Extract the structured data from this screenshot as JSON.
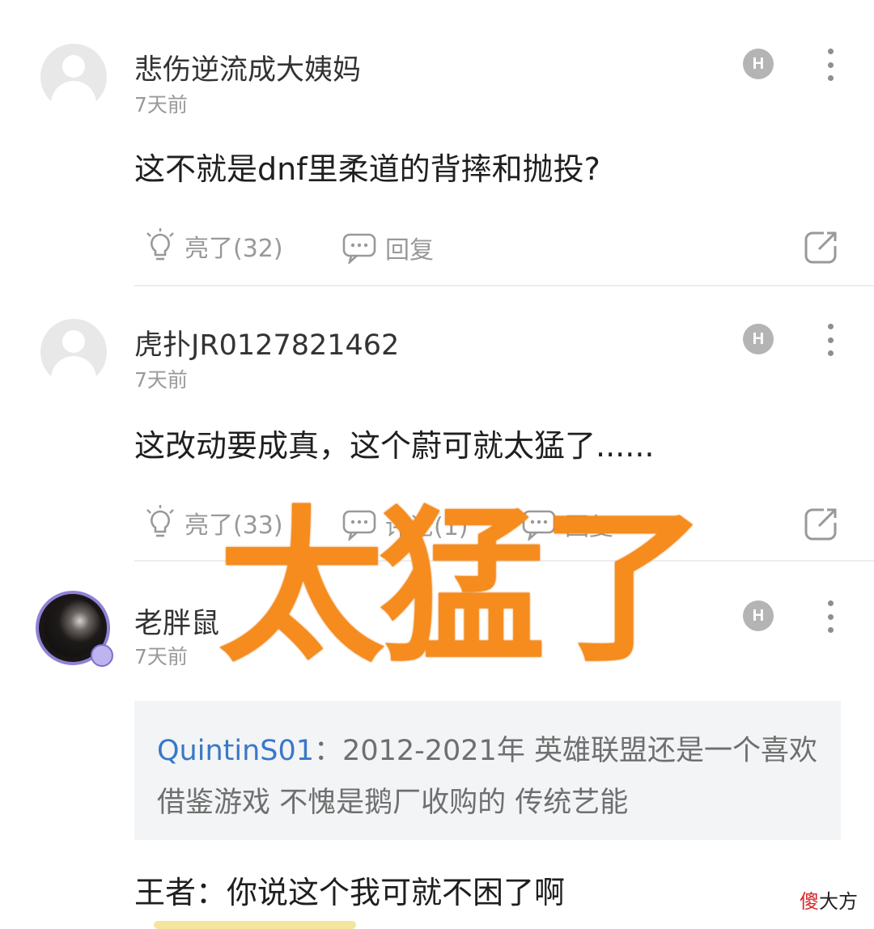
{
  "comments": [
    {
      "username": "悲伤逆流成大姨妈",
      "time": "7天前",
      "text": "这不就是dnf里柔道的背摔和抛投?",
      "like_label": "亮了(32)",
      "reply_label": "回复"
    },
    {
      "username": "虎扑JR0127821462",
      "time": "7天前",
      "text": "这改动要成真，这个蔚可就太猛了......",
      "like_label": "亮了(33)",
      "reply_count_label": "评论(1)",
      "reply_label": "回复"
    },
    {
      "username": "老胖鼠",
      "time": "7天前",
      "quote": {
        "user": "QuintinS01",
        "separator": "：",
        "text": "2012-2021年 英雄联盟还是一个喜欢借鉴游戏 不愧是鹅厂收购的 传统艺能"
      },
      "text": "王者：你说这个我可就不困了啊"
    }
  ],
  "h_badge_label": "H",
  "overlay_text": "太猛了",
  "watermark": {
    "first": "傻",
    "rest": "大方"
  },
  "colors": {
    "accent_orange": "#f58c1d",
    "link_blue": "#3a77c8",
    "watermark_red": "#d8262b"
  },
  "icons": [
    "avatar-placeholder-icon",
    "lightbulb-icon",
    "comment-icon",
    "share-icon",
    "more-icon",
    "h-badge-icon"
  ]
}
